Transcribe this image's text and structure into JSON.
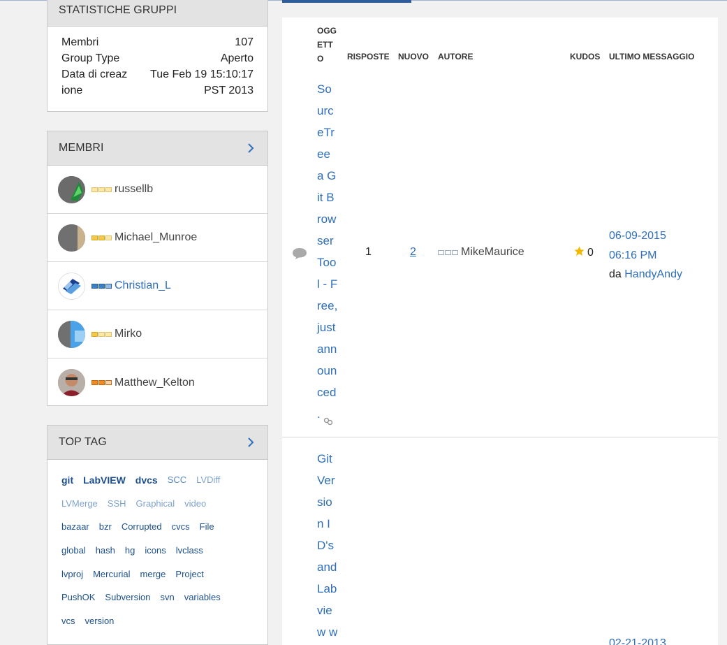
{
  "stats": {
    "title": "STATISTICHE GRUPPI",
    "rows": [
      {
        "label": "Membri",
        "value": "107"
      },
      {
        "label": "Group Type",
        "value": "Aperto"
      },
      {
        "label": "Data di creaz",
        "value": "Tue Feb 19 15:10:17"
      },
      {
        "label": "ione",
        "value": "PST 2013"
      }
    ]
  },
  "members": {
    "title": "MEMBRI",
    "items": [
      {
        "name": "russellb"
      },
      {
        "name": "Michael_Munroe"
      },
      {
        "name": "Christian_L"
      },
      {
        "name": "Mirko"
      },
      {
        "name": "Matthew_Kelton"
      }
    ]
  },
  "toptag": {
    "title": "TOP TAG",
    "rows": [
      [
        "git",
        "LabVIEW",
        "dvcs",
        "SCC",
        "LVDiff"
      ],
      [
        "LVMerge",
        "SSH",
        "Graphical",
        "video"
      ],
      [
        "bazaar",
        "bzr",
        "Corrupted",
        "cvcs",
        "File"
      ],
      [
        "global",
        "hash",
        "hg",
        "icons",
        "lvclass"
      ],
      [
        "lvproj",
        "Mercurial",
        "merge",
        "Project"
      ],
      [
        "PushOK",
        "Subversion",
        "svn",
        "variables"
      ],
      [
        "vcs",
        "version"
      ]
    ]
  },
  "board": {
    "headers": {
      "oggetto": "OGGETTO",
      "risposte": "RISPOSTE",
      "nuovo": "NUOVO",
      "autore": "AUTORE",
      "kudos": "KUDOS",
      "ultimo": "ULTIMO MESSAGGIO"
    },
    "threads": [
      {
        "subject": "SourceTree a Git Browser Tool - Free, just announced .",
        "replies": "1",
        "new": "2",
        "author": "MikeMaurice",
        "kudos": "0",
        "last_date": "06-09-2015",
        "last_time": "06:16 PM",
        "by_prefix": "da",
        "by_user": "HandyAndy"
      },
      {
        "subject": "Git Version ID's and Labview w",
        "last_date": "02-21-2013"
      }
    ]
  },
  "colors": {
    "link": "#2e6eb8",
    "panel_head": "#e3e3e3",
    "rank_gold": "#f2c94c",
    "rank_blue": "#3b7fc4",
    "rank_orange": "#f08a24",
    "star": "#f5b800"
  }
}
